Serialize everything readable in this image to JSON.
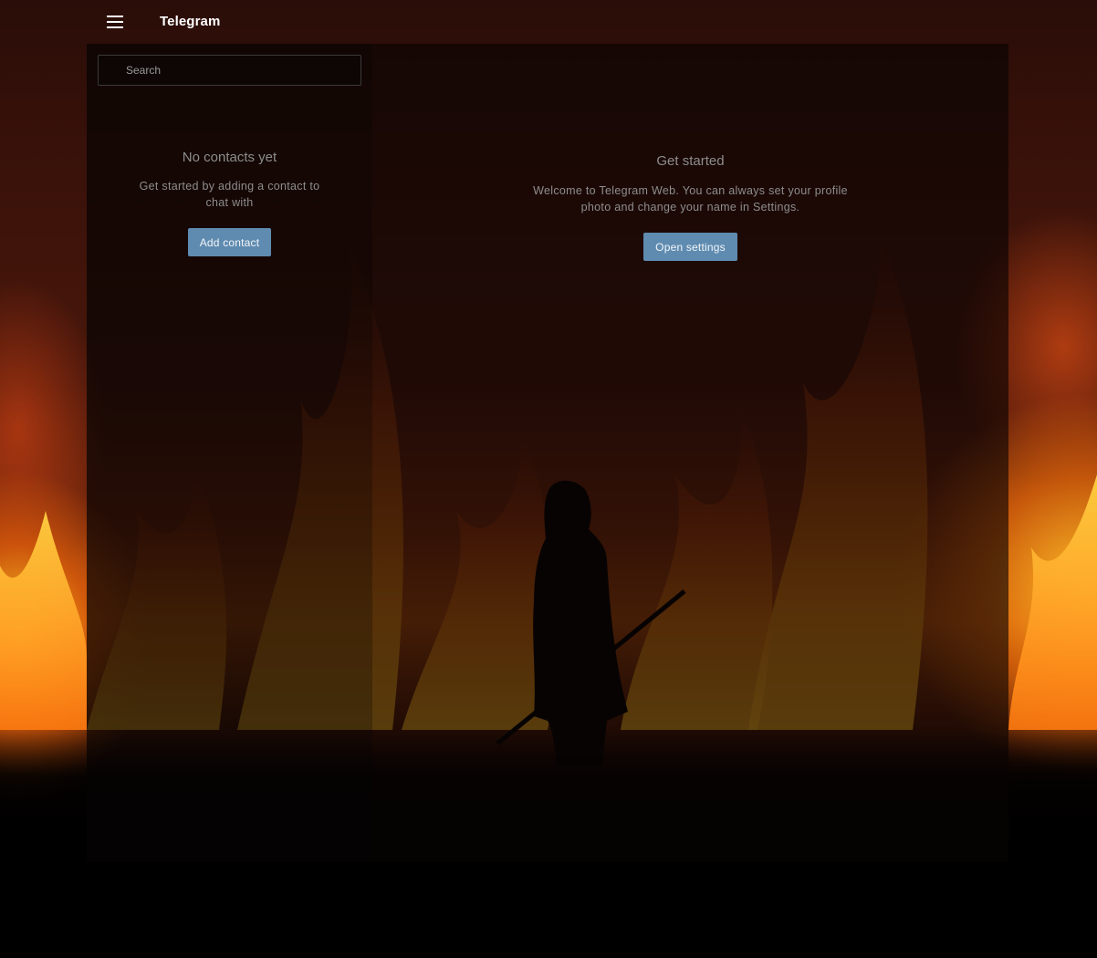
{
  "header": {
    "menu_icon": "hamburger-menu-icon",
    "title": "Telegram"
  },
  "sidebar": {
    "search": {
      "placeholder": "Search",
      "value": ""
    },
    "empty_state": {
      "title": "No contacts yet",
      "description": "Get started by adding a contact to chat with",
      "button_label": "Add contact"
    }
  },
  "main": {
    "empty_state": {
      "title": "Get started",
      "description": "Welcome to Telegram Web. You can always set your profile photo and change your name in Settings.",
      "button_label": "Open settings"
    }
  },
  "colors": {
    "accent_button": "#5f8bb0",
    "muted_text": "#8d8d8d",
    "header_text": "#ffffff"
  }
}
